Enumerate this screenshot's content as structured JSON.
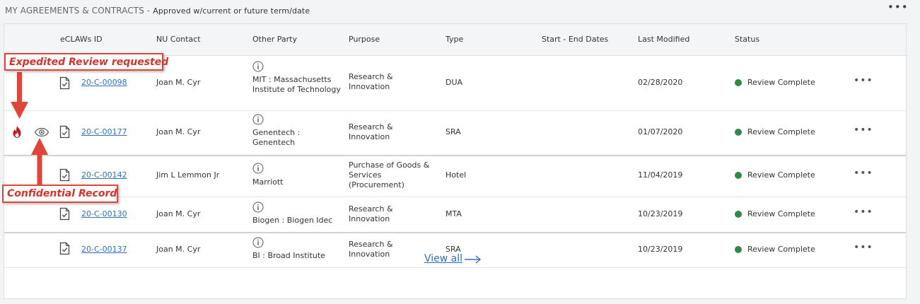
{
  "header": {
    "section_title": "MY AGREEMENTS & CONTRACTS",
    "separator": " - ",
    "section_subtitle": "Approved w/current or future term/date",
    "more_label": "•••"
  },
  "table": {
    "columns": [
      "eCLAWs ID",
      "NU Contact",
      "Other Party",
      "Purpose",
      "Type",
      "Start - End Dates",
      "Last Modified",
      "Status"
    ],
    "rows": [
      {
        "id": "20-C-00098",
        "contact": "Joan M. Cyr",
        "party": "MIT : Massachusetts Institute of Technology",
        "purpose": "Research & Innovation",
        "type": "DUA",
        "dates": "",
        "modified": "02/28/2020",
        "status": "Review Complete",
        "more": "•••"
      },
      {
        "id": "20-C-00177",
        "contact": "Joan M. Cyr",
        "party": "Genentech : Genentech",
        "purpose": "Research & Innovation",
        "type": "SRA",
        "dates": "",
        "modified": "01/07/2020",
        "status": "Review Complete",
        "more": "•••"
      },
      {
        "id": "20-C-00142",
        "contact": "Jim L Lemmon Jr",
        "party": "Marriott",
        "purpose": "Purchase of Goods & Services (Procurement)",
        "type": "Hotel",
        "dates": "",
        "modified": "11/04/2019",
        "status": "Review Complete",
        "more": "•••"
      },
      {
        "id": "20-C-00130",
        "contact": "Joan M. Cyr",
        "party": "Biogen : Biogen Idec",
        "purpose": "Research & Innovation",
        "type": "MTA",
        "dates": "",
        "modified": "10/23/2019",
        "status": "Review Complete",
        "more": "•••"
      },
      {
        "id": "20-C-00137",
        "contact": "Joan M. Cyr",
        "party": "BI : Broad Institute",
        "purpose": "Research & Innovation",
        "type": "SRA",
        "dates": "",
        "modified": "10/23/2019",
        "status": "Review Complete",
        "more": "•••"
      }
    ]
  },
  "footer": {
    "view_all": "View all"
  },
  "annotations": {
    "expedited": "Expedited Review requested",
    "confidential": "Confidential Record"
  },
  "colors": {
    "status_green": "#2f8a46",
    "link_blue": "#2f6fbf",
    "callout_red": "#e0443a",
    "flame_red": "#c8141e"
  },
  "icons": {
    "flame": "flame-icon",
    "eye": "eye-icon",
    "document": "document-check-icon",
    "info": "info-icon",
    "more": "more-horizontal-icon",
    "arrow": "arrow-right-icon"
  }
}
